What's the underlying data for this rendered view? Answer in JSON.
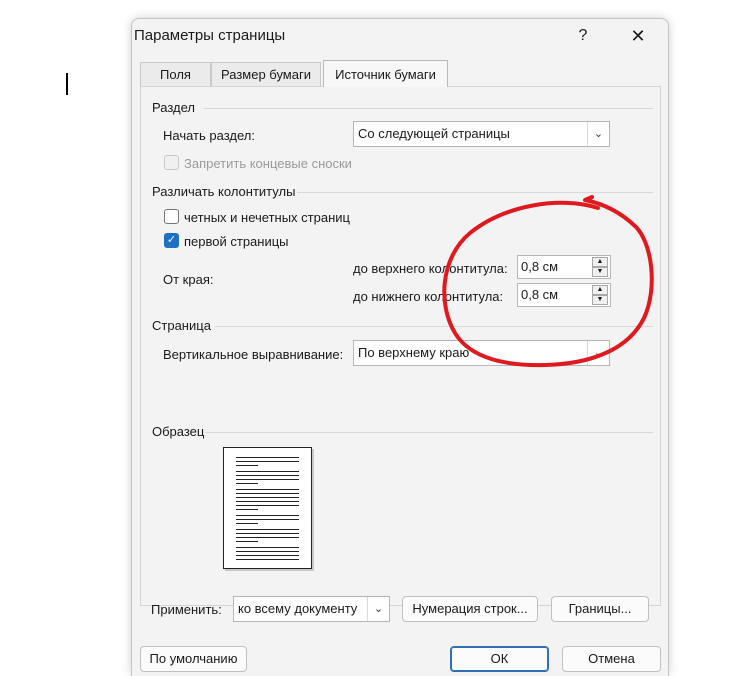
{
  "dialog": {
    "title": "Параметры страницы",
    "help": "?",
    "close": "✕"
  },
  "tabs": [
    {
      "label": "Поля",
      "active": false
    },
    {
      "label": "Размер бумаги",
      "active": false
    },
    {
      "label": "Источник бумаги",
      "active": true
    }
  ],
  "section": {
    "title": "Раздел",
    "start_label": "Начать раздел:",
    "start_value": "Со следующей страницы",
    "suppress_endnotes_label": "Запретить концевые сноски",
    "suppress_endnotes_checked": false
  },
  "headers": {
    "title": "Различать колонтитулы",
    "odd_even_label": "четных и нечетных страниц",
    "odd_even_checked": false,
    "first_page_label": "первой страницы",
    "first_page_checked": true,
    "from_edge_label": "От края:",
    "header_label": "до верхнего колонтитула:",
    "header_value": "0,8 см",
    "footer_label": "до нижнего колонтитула:",
    "footer_value": "0,8 см"
  },
  "page": {
    "title": "Страница",
    "valign_label": "Вертикальное выравнивание:",
    "valign_value": "По верхнему краю"
  },
  "preview": {
    "title": "Образец"
  },
  "apply": {
    "label": "Применить:",
    "value": "ко всему документу",
    "line_numbers_button": "Нумерация строк...",
    "borders_button": "Границы..."
  },
  "footer": {
    "default_button": "По умолчанию",
    "ok_button": "ОК",
    "cancel_button": "Отмена"
  },
  "colors": {
    "annotation": "#e0191e",
    "checkbox_checked": "#1f6fc5"
  },
  "icons": {
    "dropdown": "chevron-down-icon",
    "spin_up": "spin-up-icon",
    "spin_down": "spin-down-icon",
    "check": "checkmark-icon"
  }
}
